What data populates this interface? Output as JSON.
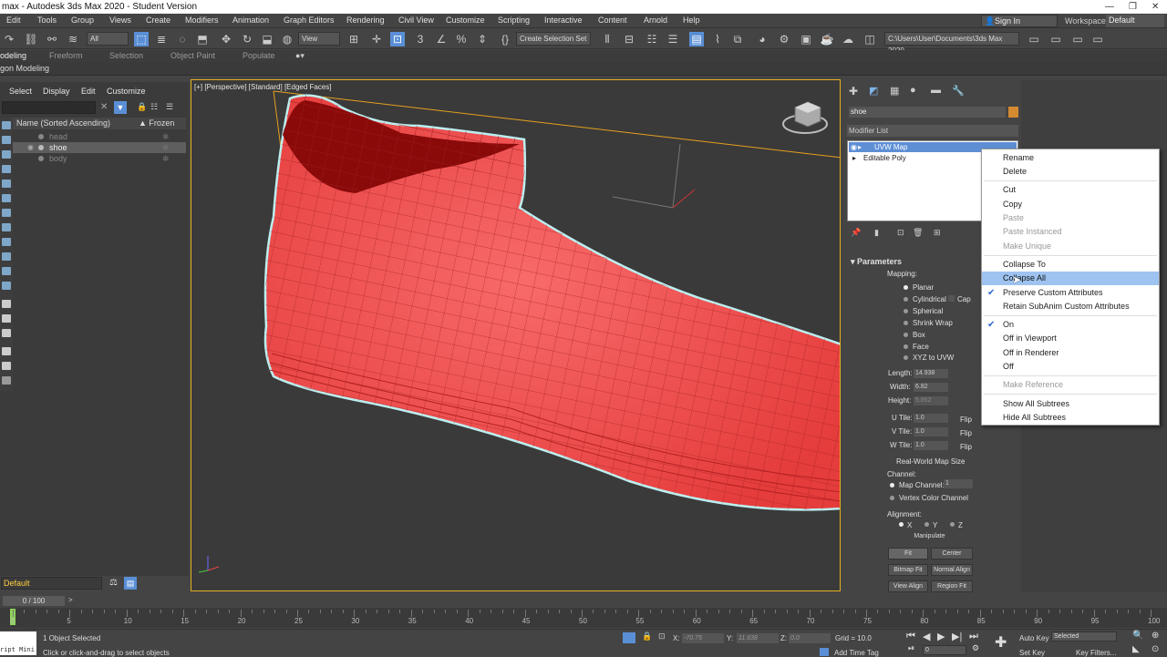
{
  "title": "max - Autodesk 3ds Max 2020 - Student Version",
  "window_controls": [
    "—",
    "❐",
    "✕"
  ],
  "menu": [
    "Edit",
    "Tools",
    "Group",
    "Views",
    "Create",
    "Modifiers",
    "Animation",
    "Graph Editors",
    "Rendering",
    "Civil View",
    "Customize",
    "Scripting",
    "Interactive",
    "Content",
    "Arnold",
    "Help"
  ],
  "signin": "Sign In",
  "workspaces_label": "Workspaces:",
  "workspaces_value": "Default",
  "toolbar": {
    "filter": "All",
    "view": "View",
    "selset": "Create Selection Set",
    "path": "C:\\Users\\User\\Documents\\3ds Max 2020"
  },
  "ribbon": {
    "tabs": [
      "odeling",
      "Freeform",
      "Selection",
      "Object Paint",
      "Populate"
    ],
    "sub": "gon Modeling"
  },
  "explorer": {
    "menu": [
      "Select",
      "Display",
      "Edit",
      "Customize"
    ],
    "col_name": "Name (Sorted Ascending)",
    "col_frozen": "▲ Frozen",
    "rows": [
      "head",
      "shoe",
      "body"
    ]
  },
  "layer": "Default",
  "viewport": {
    "label": "[+] [Perspective] [Standard] [Edged Faces]"
  },
  "cmd": {
    "object_name": "shoe",
    "modifier_list": "Modifier List",
    "stack": [
      "UVW Map",
      "Editable Poly"
    ],
    "params_title": "Parameters",
    "mapping_label": "Mapping:",
    "mapping": [
      "Planar",
      "Cylindrical",
      "Spherical",
      "Shrink Wrap",
      "Box",
      "Face",
      "XYZ to UVW"
    ],
    "cap": "Cap",
    "length_label": "Length:",
    "length": "14.938",
    "width_label": "Width:",
    "width": "6.82",
    "height_label": "Height:",
    "height": "5.852",
    "utile_label": "U Tile:",
    "utile": "1.0",
    "vtile_label": "V Tile:",
    "vtile": "1.0",
    "wtile_label": "W Tile:",
    "wtile": "1.0",
    "flip": "Flip",
    "realworld": "Real-World Map Size",
    "channel_label": "Channel:",
    "map_channel": "Map Channel:",
    "map_channel_val": "1",
    "vertex_color": "Vertex Color Channel",
    "alignment_label": "Alignment:",
    "axes": [
      "X",
      "Y",
      "Z"
    ],
    "manipulate": "Manipulate",
    "fit": "Fit",
    "center": "Center",
    "bitmap_fit": "Bitmap Fit",
    "normal_align": "Normal Align",
    "view_align": "View Align",
    "region_fit": "Region Fit"
  },
  "context_menu": [
    "Rename",
    "Delete",
    "Cut",
    "Copy",
    "Paste",
    "Paste Instanced",
    "Make Unique",
    "Collapse To",
    "Collapse All",
    "Preserve Custom Attributes",
    "Retain SubAnim Custom Attributes",
    "On",
    "Off in Viewport",
    "Off in Renderer",
    "Off",
    "Make Reference",
    "Show All Subtrees",
    "Hide All Subtrees"
  ],
  "time_slider": "0 / 100",
  "track_ticks": [
    "0",
    "5",
    "10",
    "15",
    "20",
    "25",
    "30",
    "35",
    "40",
    "45",
    "50",
    "55",
    "60",
    "65",
    "70",
    "75",
    "80",
    "85",
    "90",
    "95",
    "100"
  ],
  "status": {
    "maxscript": "ript Mini",
    "selected": "1 Object Selected",
    "prompt": "Click or click-and-drag to select objects",
    "x_label": "X:",
    "x": "-70.75",
    "y_label": "Y:",
    "y": "11.638",
    "z_label": "Z:",
    "z": "0.0",
    "grid": "Grid = 10.0",
    "add_time_tag": "Add Time Tag",
    "auto_key": "Auto Key",
    "set_key": "Set Key",
    "selected_dd": "Selected",
    "key_filters": "Key Filters...",
    "frame": "0"
  }
}
